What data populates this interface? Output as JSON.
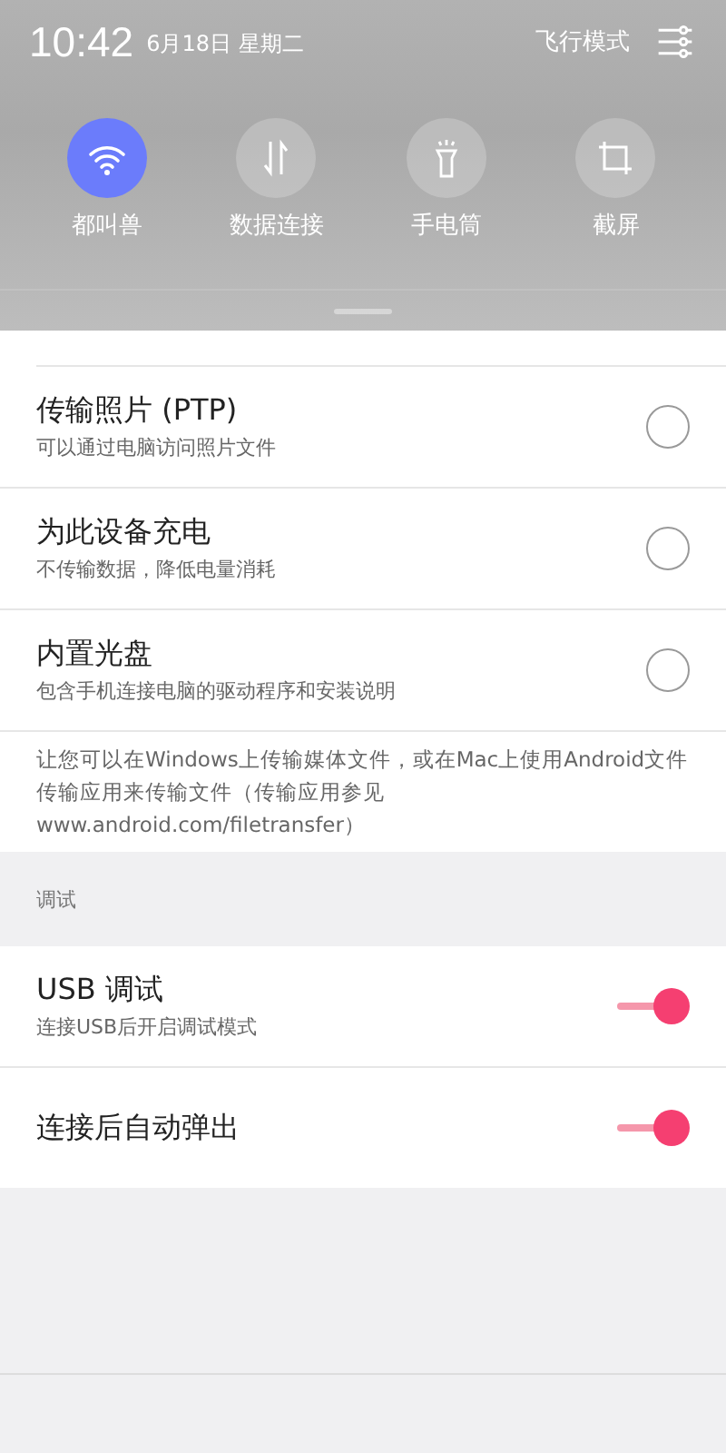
{
  "status_bar": {
    "time": "10:42",
    "date": "6月18日 星期二",
    "airplane_mode": "飞行模式"
  },
  "quick_tiles": [
    {
      "kind": "wifi",
      "label": "都叫兽",
      "on": true
    },
    {
      "kind": "data",
      "label": "数据连接",
      "on": false
    },
    {
      "kind": "flashlight",
      "label": "手电筒",
      "on": false
    },
    {
      "kind": "screenshot",
      "label": "截屏",
      "on": false
    }
  ],
  "usb_options": [
    {
      "title": "传输照片 (PTP)",
      "subtitle": "可以通过电脑访问照片文件",
      "selected": false
    },
    {
      "title": "为此设备充电",
      "subtitle": "不传输数据，降低电量消耗",
      "selected": false
    },
    {
      "title": "内置光盘",
      "subtitle": "包含手机连接电脑的驱动程序和安装说明",
      "selected": false
    }
  ],
  "note": "让您可以在Windows上传输媒体文件，或在Mac上使用Android文件传输应用来传输文件（传输应用参见www.android.com/filetransfer）",
  "debug_section": {
    "header": "调试",
    "items": [
      {
        "title": "USB 调试",
        "subtitle": "连接USB后开启调试模式",
        "on": true
      },
      {
        "title": "连接后自动弹出",
        "on": true
      }
    ]
  }
}
